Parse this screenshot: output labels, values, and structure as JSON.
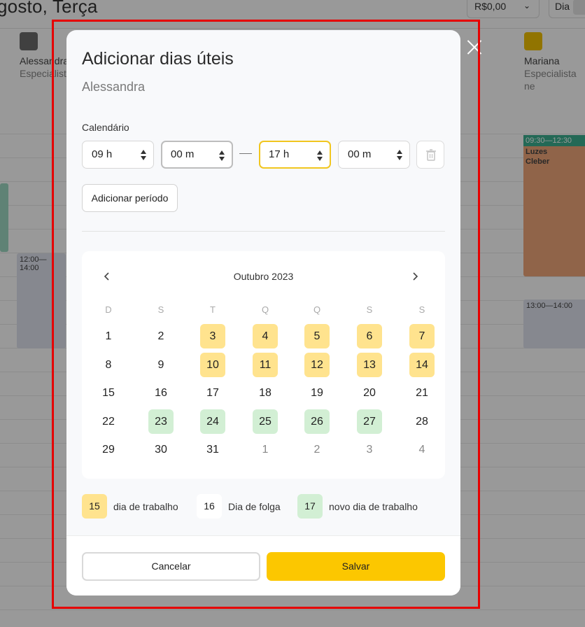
{
  "background": {
    "title": "gosto, Terça",
    "price_label": "R$0,00",
    "view_label": "Dia",
    "staff": [
      {
        "name": "Alessandra",
        "role": "Especialista"
      },
      {
        "name": "Mariana",
        "role": "Especialista ne"
      }
    ],
    "events": [
      {
        "time": "12:00—14:00"
      },
      {
        "time": "09:30—12:30",
        "line1": "Luzes",
        "line2": "Cleber"
      },
      {
        "time": "13:00—14:00"
      }
    ]
  },
  "modal": {
    "title": "Adicionar dias úteis",
    "subtitle": "Alessandra",
    "calendar_label": "Calendário",
    "start_hour": "09 h",
    "start_min": "00 m",
    "end_hour": "17 h",
    "end_min": "00 m",
    "add_period_label": "Adicionar período",
    "calendar": {
      "month": "Outubro 2023",
      "weekdays": [
        "D",
        "S",
        "T",
        "Q",
        "Q",
        "S",
        "S"
      ],
      "weeks": [
        [
          {
            "d": "1",
            "s": ""
          },
          {
            "d": "2",
            "s": ""
          },
          {
            "d": "3",
            "s": "work"
          },
          {
            "d": "4",
            "s": "work"
          },
          {
            "d": "5",
            "s": "work"
          },
          {
            "d": "6",
            "s": "work"
          },
          {
            "d": "7",
            "s": "work"
          }
        ],
        [
          {
            "d": "8",
            "s": ""
          },
          {
            "d": "9",
            "s": ""
          },
          {
            "d": "10",
            "s": "work"
          },
          {
            "d": "11",
            "s": "work"
          },
          {
            "d": "12",
            "s": "work"
          },
          {
            "d": "13",
            "s": "work"
          },
          {
            "d": "14",
            "s": "work"
          }
        ],
        [
          {
            "d": "15",
            "s": ""
          },
          {
            "d": "16",
            "s": ""
          },
          {
            "d": "17",
            "s": ""
          },
          {
            "d": "18",
            "s": ""
          },
          {
            "d": "19",
            "s": ""
          },
          {
            "d": "20",
            "s": ""
          },
          {
            "d": "21",
            "s": ""
          }
        ],
        [
          {
            "d": "22",
            "s": ""
          },
          {
            "d": "23",
            "s": "new"
          },
          {
            "d": "24",
            "s": "new"
          },
          {
            "d": "25",
            "s": "new"
          },
          {
            "d": "26",
            "s": "new"
          },
          {
            "d": "27",
            "s": "new"
          },
          {
            "d": "28",
            "s": ""
          }
        ],
        [
          {
            "d": "29",
            "s": ""
          },
          {
            "d": "30",
            "s": ""
          },
          {
            "d": "31",
            "s": ""
          },
          {
            "d": "1",
            "s": "muted"
          },
          {
            "d": "2",
            "s": "muted"
          },
          {
            "d": "3",
            "s": "muted"
          },
          {
            "d": "4",
            "s": "muted"
          }
        ]
      ]
    },
    "legend": [
      {
        "num": "15",
        "label": "dia de trabalho",
        "color": "#ffe38e"
      },
      {
        "num": "16",
        "label": "Dia de folga",
        "color": "#ffffff"
      },
      {
        "num": "17",
        "label": "novo dia de trabalho",
        "color": "#d2efd4"
      }
    ],
    "cancel_label": "Cancelar",
    "save_label": "Salvar"
  },
  "colors": {
    "accent": "#fcc700",
    "work_day": "#ffe38e",
    "new_work_day": "#d2efd4",
    "highlight_frame": "#e60000"
  }
}
